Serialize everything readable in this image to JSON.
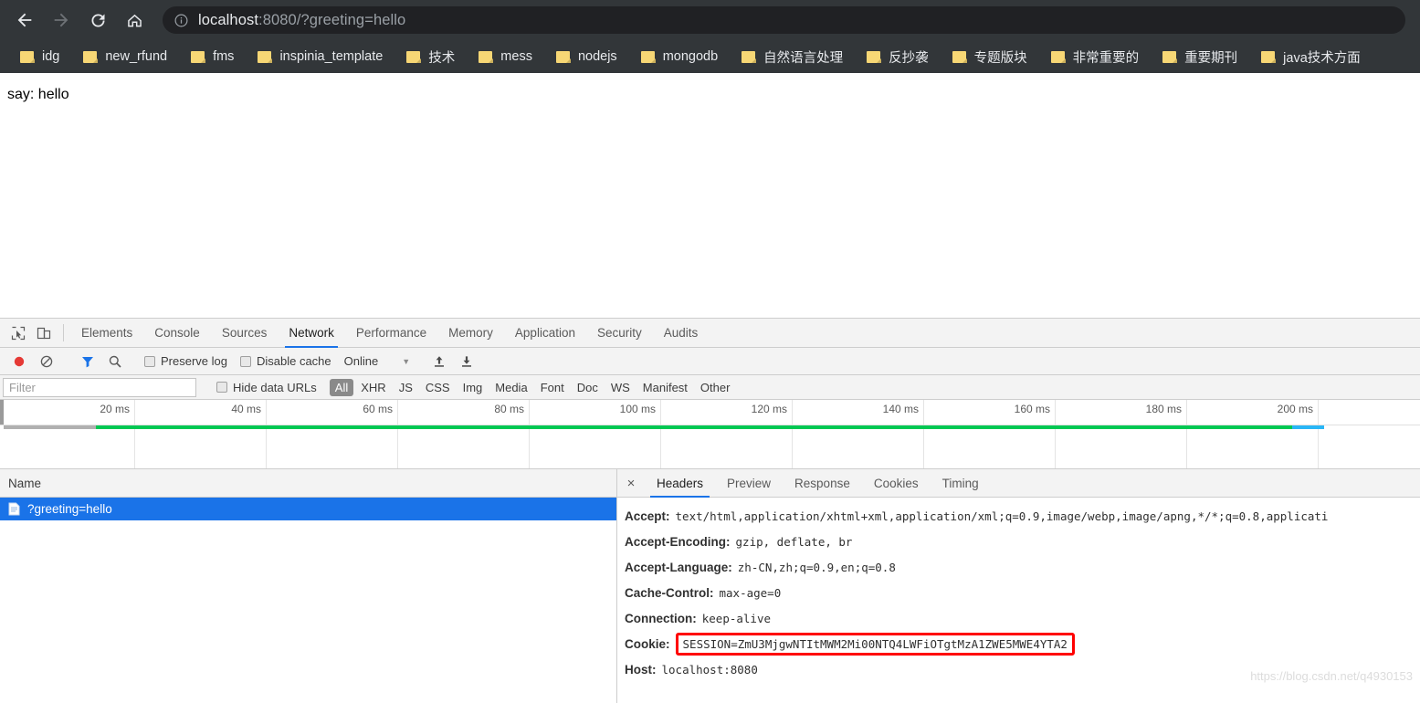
{
  "browser": {
    "nav": {
      "back_label": "Back",
      "forward_label": "Forward",
      "reload_label": "Reload",
      "home_label": "Home"
    },
    "omnibox": {
      "info_icon": "info-circle-icon",
      "url_host": "localhost",
      "url_rest": ":8080/?greeting=hello",
      "full_url": "localhost:8080/?greeting=hello"
    },
    "bookmarks": [
      {
        "label": "idg"
      },
      {
        "label": "new_rfund"
      },
      {
        "label": "fms"
      },
      {
        "label": "inspinia_template"
      },
      {
        "label": "技术"
      },
      {
        "label": "mess"
      },
      {
        "label": "nodejs"
      },
      {
        "label": "mongodb"
      },
      {
        "label": "自然语言处理"
      },
      {
        "label": "反抄袭"
      },
      {
        "label": "专题版块"
      },
      {
        "label": "非常重要的"
      },
      {
        "label": "重要期刊"
      },
      {
        "label": "java技术方面"
      }
    ]
  },
  "page": {
    "body_text": "say: hello"
  },
  "devtools": {
    "main_tabs": [
      {
        "label": "Elements",
        "active": false
      },
      {
        "label": "Console",
        "active": false
      },
      {
        "label": "Sources",
        "active": false
      },
      {
        "label": "Network",
        "active": true
      },
      {
        "label": "Performance",
        "active": false
      },
      {
        "label": "Memory",
        "active": false
      },
      {
        "label": "Application",
        "active": false
      },
      {
        "label": "Security",
        "active": false
      },
      {
        "label": "Audits",
        "active": false
      }
    ],
    "toolbar": {
      "record_label": "Record",
      "clear_label": "Clear",
      "filter_label": "Filter",
      "search_label": "Search",
      "preserve_log_label": "Preserve log",
      "preserve_log_checked": false,
      "disable_cache_label": "Disable cache",
      "disable_cache_checked": false,
      "throttle_value": "Online",
      "import_label": "Import HAR",
      "export_label": "Export HAR"
    },
    "filterbar": {
      "filter_placeholder": "Filter",
      "filter_value": "",
      "hide_data_urls_label": "Hide data URLs",
      "hide_data_urls_checked": false,
      "types": [
        {
          "label": "All",
          "active": true
        },
        {
          "label": "XHR",
          "active": false
        },
        {
          "label": "JS",
          "active": false
        },
        {
          "label": "CSS",
          "active": false
        },
        {
          "label": "Img",
          "active": false
        },
        {
          "label": "Media",
          "active": false
        },
        {
          "label": "Font",
          "active": false
        },
        {
          "label": "Doc",
          "active": false
        },
        {
          "label": "WS",
          "active": false
        },
        {
          "label": "Manifest",
          "active": false
        },
        {
          "label": "Other",
          "active": false
        }
      ]
    },
    "overview": {
      "ticks": [
        "20 ms",
        "40 ms",
        "60 ms",
        "80 ms",
        "100 ms",
        "120 ms",
        "140 ms",
        "160 ms",
        "180 ms",
        "200 ms"
      ],
      "bar_color_loading": "#00c853",
      "bar_color_idle": "#b0b0b0",
      "bar_color_domcontent": "#29b6f6"
    },
    "requests": {
      "column_header_name": "Name",
      "rows": [
        {
          "name": "?greeting=hello",
          "selected": true,
          "icon": "document-icon"
        }
      ]
    },
    "details": {
      "close_label": "×",
      "tabs": [
        {
          "label": "Headers",
          "active": true
        },
        {
          "label": "Preview",
          "active": false
        },
        {
          "label": "Response",
          "active": false
        },
        {
          "label": "Cookies",
          "active": false
        },
        {
          "label": "Timing",
          "active": false
        }
      ],
      "headers": [
        {
          "name": "Accept:",
          "value": "text/html,application/xhtml+xml,application/xml;q=0.9,image/webp,image/apng,*/*;q=0.8,applicati",
          "highlighted": false
        },
        {
          "name": "Accept-Encoding:",
          "value": "gzip, deflate, br",
          "highlighted": false
        },
        {
          "name": "Accept-Language:",
          "value": "zh-CN,zh;q=0.9,en;q=0.8",
          "highlighted": false
        },
        {
          "name": "Cache-Control:",
          "value": "max-age=0",
          "highlighted": false
        },
        {
          "name": "Connection:",
          "value": "keep-alive",
          "highlighted": false
        },
        {
          "name": "Cookie:",
          "value": "SESSION=ZmU3MjgwNTItMWM2Mi00NTQ4LWFiOTgtMzA1ZWE5MWE4YTA2",
          "highlighted": true
        },
        {
          "name": "Host:",
          "value": "localhost:8080",
          "highlighted": false
        }
      ],
      "highlight_color": "#ff0000"
    }
  },
  "watermark": {
    "text": "https://blog.csdn.net/q4930153"
  }
}
